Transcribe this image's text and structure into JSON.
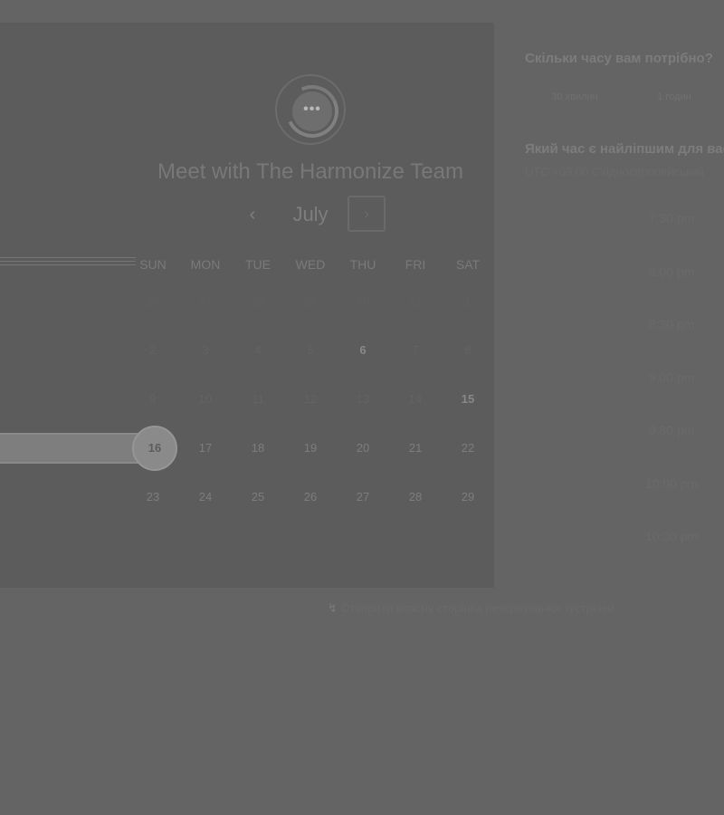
{
  "logo": {
    "glyph": "•••"
  },
  "header": {
    "title": "Meet with The Harmonize Team"
  },
  "calendar": {
    "month": "July",
    "prev_glyph": "‹",
    "next_glyph": "›",
    "weekdays": [
      "SUN",
      "MON",
      "TUE",
      "WED",
      "THU",
      "FRI",
      "SAT"
    ],
    "weeks": [
      [
        "26",
        "27",
        "28",
        "29",
        "30",
        "31",
        "1"
      ],
      [
        "2",
        "3",
        "4",
        "5",
        "6",
        "7",
        "8"
      ],
      [
        "9",
        "10",
        "11",
        "12",
        "13",
        "14",
        "15"
      ],
      [
        "16",
        "17",
        "18",
        "19",
        "20",
        "21",
        "22"
      ],
      [
        "23",
        "24",
        "25",
        "26",
        "27",
        "28",
        "29"
      ]
    ],
    "selected_day": "16"
  },
  "sidebar": {
    "duration_question": "Скільки часу вам потрібно?",
    "durations": [
      "30 хвилин",
      "1 годин"
    ],
    "time_question": "Який час є найліпшим для вас?",
    "timezone": "UTC +03:00 Східноєвропейський",
    "slots": [
      "7:30 pm",
      "8:00 pm",
      "8:30 pm",
      "9:00 pm",
      "9:30 pm",
      "10:00 pm",
      "10:30 pm"
    ]
  },
  "footer": {
    "icon": "↯",
    "link_text": "Створити власну сторінка резервування зустрічей"
  }
}
